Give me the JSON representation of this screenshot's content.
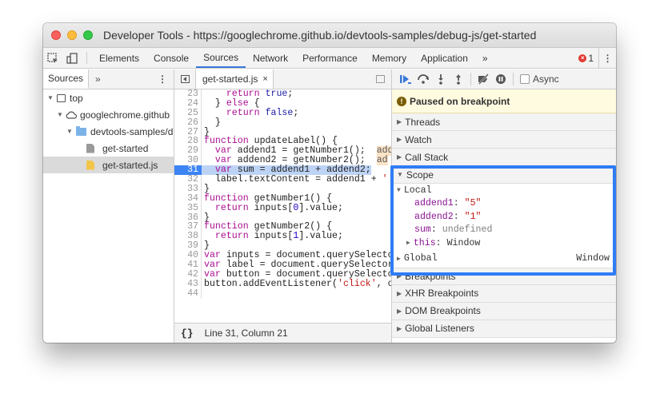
{
  "window": {
    "title": "Developer Tools - https://googlechrome.github.io/devtools-samples/debug-js/get-started"
  },
  "tabs": [
    "Elements",
    "Console",
    "Sources",
    "Network",
    "Performance",
    "Memory",
    "Application"
  ],
  "tabs_more": "»",
  "error_count": "1",
  "kebab": "⋮",
  "navigator": {
    "tab": "Sources",
    "more": "»",
    "items": [
      {
        "label": "top"
      },
      {
        "label": "googlechrome.github"
      },
      {
        "label": "devtools-samples/d"
      },
      {
        "label": "get-started"
      },
      {
        "label": "get-started.js"
      }
    ]
  },
  "editor": {
    "file_tab": "get-started.js",
    "close": "×",
    "status_braces": "{}",
    "status": "Line 31, Column 21",
    "lines": [
      {
        "n": "23",
        "t": "    return true;"
      },
      {
        "n": "24",
        "t": "  } else {"
      },
      {
        "n": "25",
        "t": "    return false;"
      },
      {
        "n": "26",
        "t": "  }"
      },
      {
        "n": "27",
        "t": "}"
      },
      {
        "n": "28",
        "t": "function updateLabel() {"
      },
      {
        "n": "29",
        "t": "  var addend1 = getNumber1();  ",
        "inline": "add"
      },
      {
        "n": "30",
        "t": "  var addend2 = getNumber2();  ",
        "inline": "ad"
      },
      {
        "n": "31",
        "t": "  var sum = addend1 + addend2;"
      },
      {
        "n": "32",
        "t": "  label.textContent = addend1 + '"
      },
      {
        "n": "33",
        "t": "}"
      },
      {
        "n": "34",
        "t": "function getNumber1() {"
      },
      {
        "n": "35",
        "t": "  return inputs[0].value;"
      },
      {
        "n": "36",
        "t": "}"
      },
      {
        "n": "37",
        "t": "function getNumber2() {"
      },
      {
        "n": "38",
        "t": "  return inputs[1].value;"
      },
      {
        "n": "39",
        "t": "}"
      },
      {
        "n": "40",
        "t": "var inputs = document.querySelecto"
      },
      {
        "n": "41",
        "t": "var label = document.querySelector"
      },
      {
        "n": "42",
        "t": "var button = document.querySelecto"
      },
      {
        "n": "43",
        "t": "button.addEventListener('click', o"
      },
      {
        "n": "44",
        "t": ""
      }
    ]
  },
  "debugger": {
    "async_label": "Async",
    "paused": "Paused on breakpoint",
    "panes_top": [
      "Threads",
      "Watch",
      "Call Stack"
    ],
    "scope": {
      "title": "Scope",
      "local": "Local",
      "vars": [
        {
          "name": "addend1",
          "value": "\"5\""
        },
        {
          "name": "addend2",
          "value": "\"1\""
        },
        {
          "name": "sum",
          "value": "undefined"
        }
      ],
      "this_name": "this",
      "this_value": "Window",
      "global": "Global",
      "global_value": "Window"
    },
    "panes_bottom": [
      "Breakpoints",
      "XHR Breakpoints",
      "DOM Breakpoints",
      "Global Listeners"
    ]
  },
  "colors": {
    "accent": "#3879d9",
    "highlight": "#2f7cf6",
    "breakpoint": "#3d84f5"
  }
}
